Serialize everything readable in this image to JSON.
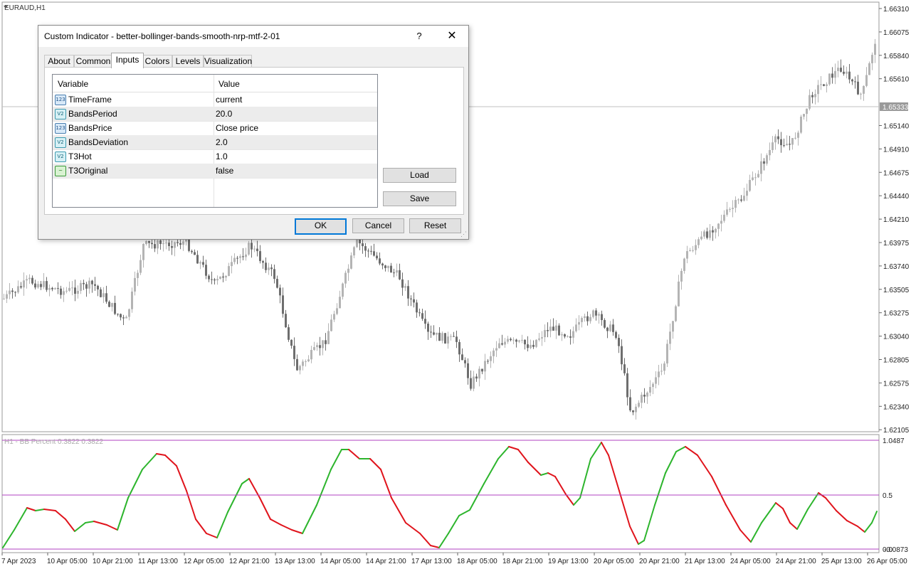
{
  "chart": {
    "symbol_label": "EURAUD,H1",
    "price_ticks": [
      "1.66310",
      "1.66075",
      "1.65840",
      "1.65610",
      "1.65333",
      "1.65140",
      "1.64910",
      "1.64675",
      "1.64440",
      "1.64210",
      "1.63975",
      "1.63740",
      "1.63505",
      "1.63275",
      "1.63040",
      "1.62805",
      "1.62575",
      "1.62340",
      "1.62105"
    ],
    "current_price": "1.65333",
    "time_labels": [
      "7 Apr 2023",
      "10 Apr 05:00",
      "10 Apr 21:00",
      "11 Apr 13:00",
      "12 Apr 05:00",
      "12 Apr 21:00",
      "13 Apr 13:00",
      "14 Apr 05:00",
      "14 Apr 21:00",
      "17 Apr 13:00",
      "18 Apr 05:00",
      "18 Apr 21:00",
      "19 Apr 13:00",
      "20 Apr 05:00",
      "20 Apr 21:00",
      "21 Apr 13:00",
      "24 Apr 05:00",
      "24 Apr 21:00",
      "25 Apr 13:00",
      "26 Apr 05:00"
    ],
    "indicator_label": "H1 - BB Percent 0.3822 0.3822",
    "indicator_ticks": [
      "1.0487",
      "0.5",
      "0.0"
    ],
    "indicator_tick_overlap": "-0.0873",
    "colors": {
      "up": "#2db52d",
      "down": "#e0141c",
      "level": "#b040c0",
      "bear_candle": "#6e6e6e",
      "bull_candle": "#b4b4b4"
    }
  },
  "dialog": {
    "title": "Custom Indicator - better-bollinger-bands-smooth-nrp-mtf-2-01",
    "help": "?",
    "close": "✕",
    "tabs": [
      "About",
      "Common",
      "Inputs",
      "Colors",
      "Levels",
      "Visualization"
    ],
    "active_tab": "Inputs",
    "headers": {
      "variable": "Variable",
      "value": "Value"
    },
    "rows": [
      {
        "icon": "123",
        "kind": "int",
        "name": "TimeFrame",
        "value": "current"
      },
      {
        "icon": "V2",
        "kind": "double",
        "name": "BandsPeriod",
        "value": "20.0"
      },
      {
        "icon": "123",
        "kind": "int",
        "name": "BandsPrice",
        "value": "Close price"
      },
      {
        "icon": "V2",
        "kind": "double",
        "name": "BandsDeviation",
        "value": "2.0"
      },
      {
        "icon": "V2",
        "kind": "double",
        "name": "T3Hot",
        "value": "1.0"
      },
      {
        "icon": "~",
        "kind": "bool",
        "name": "T3Original",
        "value": "false"
      }
    ],
    "buttons": {
      "load": "Load",
      "save": "Save",
      "ok": "OK",
      "cancel": "Cancel",
      "reset": "Reset"
    }
  }
}
